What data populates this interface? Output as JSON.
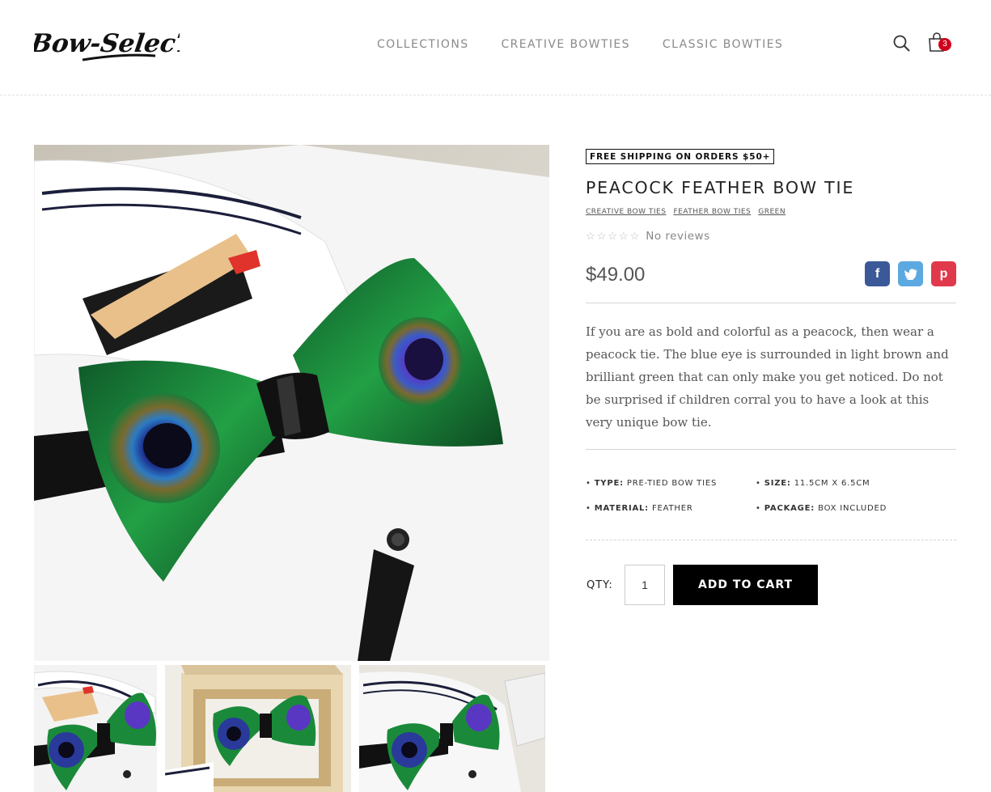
{
  "brand": {
    "logo_text": "Bow-SelecTie"
  },
  "nav": {
    "items": [
      "COLLECTIONS",
      "CREATIVE BOWTIES",
      "CLASSIC BOWTIES"
    ]
  },
  "header": {
    "cart_count": "3",
    "search_icon": "search-icon",
    "cart_icon": "shopping-bag-icon"
  },
  "product": {
    "shipping_badge": "FREE SHIPPING ON ORDERS $50+",
    "title": "PEACOCK FEATHER BOW TIE",
    "tags": [
      "CREATIVE BOW TIES",
      "FEATHER BOW TIES",
      "GREEN"
    ],
    "rating_stars": "☆☆☆☆☆",
    "reviews_text": "No reviews",
    "price": "$49.00",
    "description": "If you are as bold and colorful as a peacock, then wear a peacock tie. The blue eye is surrounded in light brown and brilliant green that can only make you get noticed. Do not be surprised if children corral you to have a look at this very unique bow tie.",
    "specs": [
      {
        "label": "TYPE:",
        "value": "PRE-TIED BOW TIES"
      },
      {
        "label": "SIZE:",
        "value": "11.5CM X 6.5CM"
      },
      {
        "label": "MATERIAL:",
        "value": "FEATHER"
      },
      {
        "label": "PACKAGE:",
        "value": "BOX INCLUDED"
      }
    ],
    "qty_label": "QTY:",
    "qty_value": "1",
    "add_to_cart": "ADD TO CART"
  },
  "share": {
    "facebook": "f",
    "twitter": "t",
    "pinterest": "p"
  },
  "colors": {
    "accent": "#000000",
    "badge_red": "#d0021b",
    "facebook": "#3b5998",
    "twitter": "#5ba9e0",
    "pinterest": "#e0394b"
  }
}
